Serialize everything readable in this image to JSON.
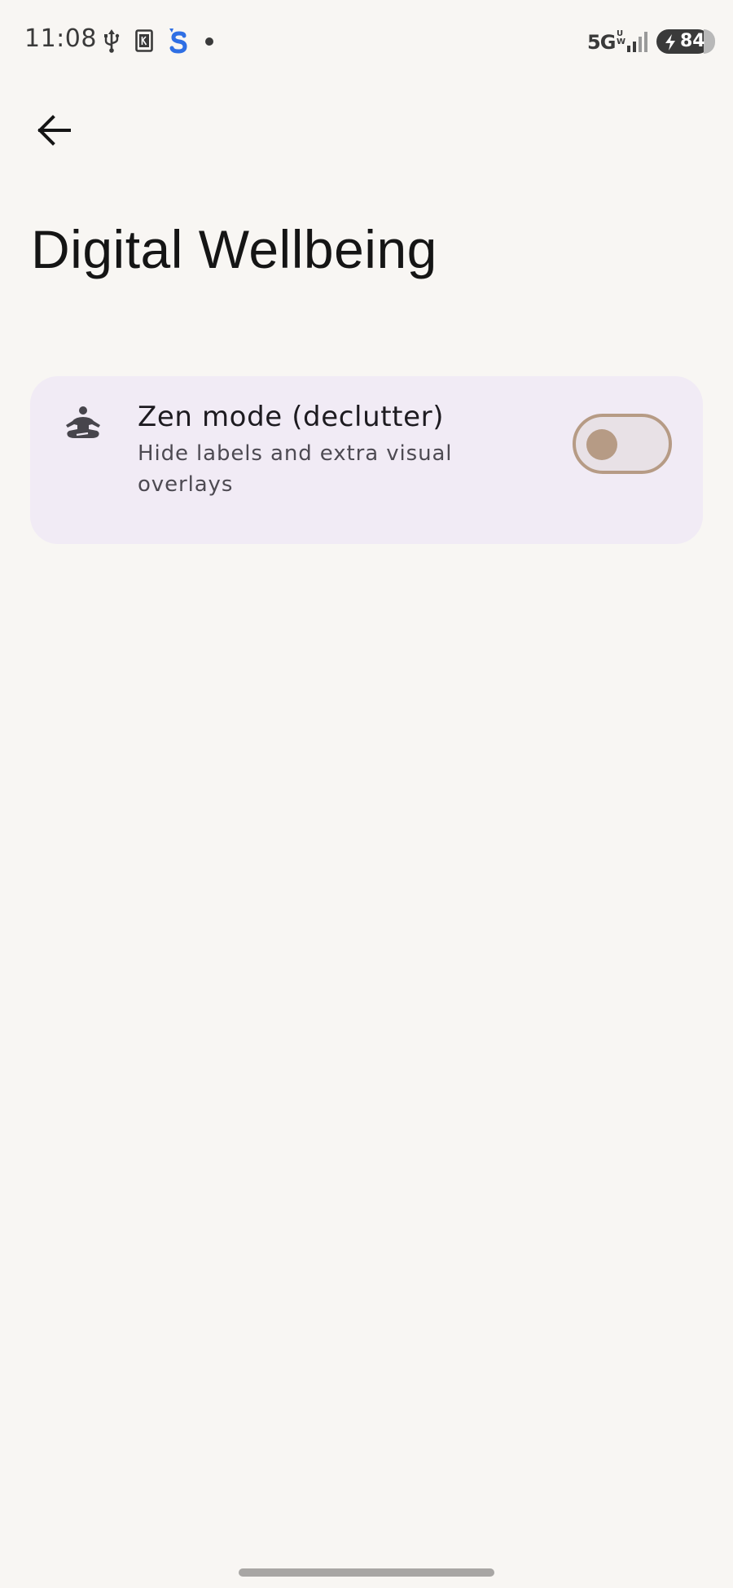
{
  "status_bar": {
    "time": "11:08",
    "network": "5G",
    "network_sub": "UW",
    "battery_level": "84",
    "icons": [
      "usb-icon",
      "k-app-icon",
      "s-app-icon",
      "notification-dot-icon",
      "signal-icon",
      "battery-charging-icon"
    ]
  },
  "header": {
    "back_icon": "arrow-back-icon",
    "title": "Digital Wellbeing"
  },
  "settings": [
    {
      "icon": "meditation-icon",
      "title": "Zen mode (declutter)",
      "description": "Hide labels and extra visual overlays",
      "enabled": false
    }
  ],
  "colors": {
    "background": "#f8f6f3",
    "card": "#f1ebf5",
    "toggle_accent": "#b69b85",
    "toggle_track": "#e8e1e6"
  }
}
